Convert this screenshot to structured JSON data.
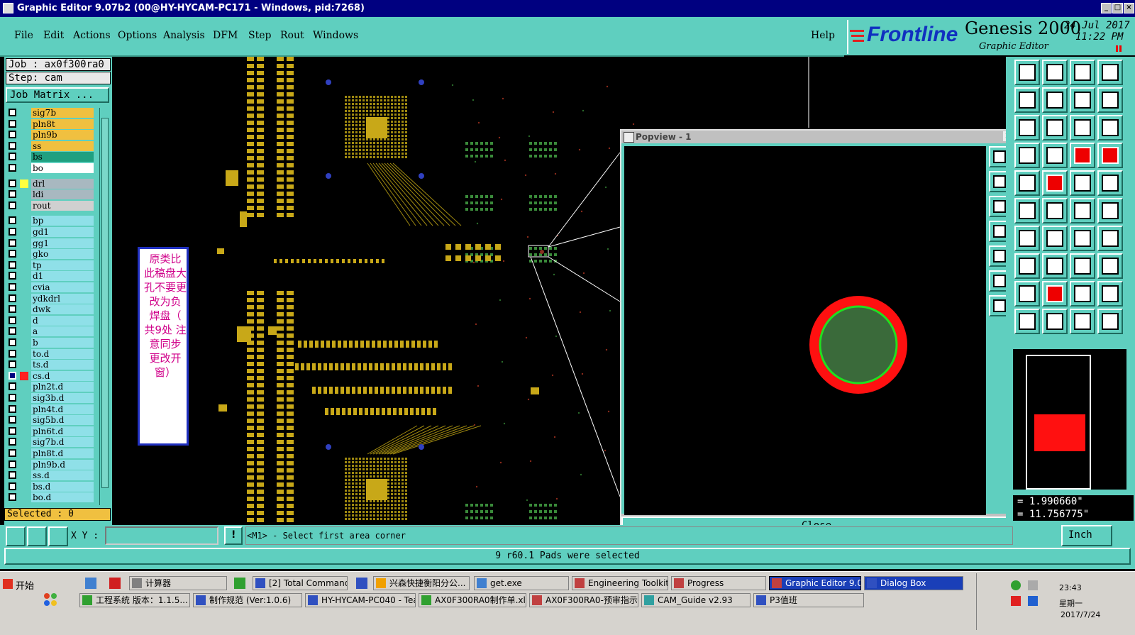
{
  "window": {
    "title": "Graphic Editor 9.07b2 (00@HY-HYCAM-PC171 - Windows, pid:7268)"
  },
  "menu": [
    "File",
    "Edit",
    "Actions",
    "Options",
    "Analysis",
    "DFM",
    "Step",
    "Rout",
    "Windows"
  ],
  "help_label": "Help",
  "brand": {
    "logo": "Frontline",
    "product": "Genesis 2000",
    "subtitle": "Graphic Editor",
    "date": "24 Jul 2017",
    "time": "11:22 PM"
  },
  "job": {
    "job_label": "Job  : ax0f300ra0",
    "step_label": "Step: cam",
    "matrix_button": "Job Matrix ..."
  },
  "layers": [
    {
      "name": "sig7b",
      "color": "#f0c040"
    },
    {
      "name": "pln8t",
      "color": "#f0c040"
    },
    {
      "name": "pln9b",
      "color": "#f0c040"
    },
    {
      "name": "ss",
      "color": "#f0c040"
    },
    {
      "name": "bs",
      "color": "#20a080"
    },
    {
      "name": "bo",
      "color": "#ffffff"
    },
    {
      "name": "drl",
      "color": "#a8b8c0",
      "swatch": "#ffff40",
      "gap": true
    },
    {
      "name": "ldi",
      "color": "#a8b8c0"
    },
    {
      "name": "rout",
      "color": "#d0d0d0"
    },
    {
      "name": "bp",
      "color": "#8fe0e8",
      "gap": true
    },
    {
      "name": "gd1",
      "color": "#8fe0e8"
    },
    {
      "name": "gg1",
      "color": "#8fe0e8"
    },
    {
      "name": "gko",
      "color": "#8fe0e8"
    },
    {
      "name": "tp",
      "color": "#8fe0e8"
    },
    {
      "name": "d1",
      "color": "#8fe0e8"
    },
    {
      "name": "cvia",
      "color": "#8fe0e8"
    },
    {
      "name": "ydkdrl",
      "color": "#8fe0e8"
    },
    {
      "name": "dwk",
      "color": "#8fe0e8"
    },
    {
      "name": "d",
      "color": "#8fe0e8"
    },
    {
      "name": "a",
      "color": "#8fe0e8"
    },
    {
      "name": "b",
      "color": "#8fe0e8"
    },
    {
      "name": "to.d",
      "color": "#8fe0e8"
    },
    {
      "name": "ts.d",
      "color": "#8fe0e8"
    },
    {
      "name": "cs.d",
      "color": "#8fe0e8",
      "swatch": "#ff2020",
      "active": true
    },
    {
      "name": "pln2t.d",
      "color": "#8fe0e8"
    },
    {
      "name": "sig3b.d",
      "color": "#8fe0e8"
    },
    {
      "name": "pln4t.d",
      "color": "#8fe0e8"
    },
    {
      "name": "sig5b.d",
      "color": "#8fe0e8"
    },
    {
      "name": "pln6t.d",
      "color": "#8fe0e8"
    },
    {
      "name": "sig7b.d",
      "color": "#8fe0e8"
    },
    {
      "name": "pln8t.d",
      "color": "#8fe0e8"
    },
    {
      "name": "pln9b.d",
      "color": "#8fe0e8"
    },
    {
      "name": "ss.d",
      "color": "#8fe0e8"
    },
    {
      "name": "bs.d",
      "color": "#8fe0e8"
    },
    {
      "name": "bo.d",
      "color": "#8fe0e8"
    }
  ],
  "selected_label": "Selected : 0",
  "annotation": {
    "lines": [
      "原",
      "比",
      "类",
      "盘",
      "此",
      "大",
      "稿",
      "孔",
      "更",
      "要",
      "不",
      "负",
      "为",
      "改",
      "盘（",
      "焊",
      "共9处",
      "注",
      "意",
      "同步",
      "更改开",
      "窗）"
    ],
    "col1": "此稿孔不改焊共9意更窗",
    "text": [
      "原类比",
      "此稿盘大",
      "孔不要更",
      "改为负",
      "焊盘（",
      "共9处  注",
      "意同步",
      "更改开",
      "窗）"
    ]
  },
  "popview": {
    "title": "Popview - 1",
    "close_label": "Close"
  },
  "coords": {
    "x": "= 1.990660\"",
    "y": "= 11.756775\"",
    "units": "Inch"
  },
  "command": {
    "xy_label": "X Y :",
    "xy_value": "",
    "prompt": "<M1> - Select first area corner"
  },
  "status": "9 r60.1 Pads were selected",
  "taskbar": {
    "start": "开始",
    "row1": [
      "计算器",
      "[2] Total Commander...",
      "兴森快捷衡阳分公...",
      "get.exe",
      "Engineering Toolkit 9...",
      "Progress",
      "Graphic Editor 9.0...",
      "Dialog Box"
    ],
    "row2": [
      "工程系统  版本：1.1.5...",
      "制作规范 (Ver:1.0.6)",
      "HY-HYCAM-PC040 - Tea...",
      "AX0F300RA0制作单.xls ...",
      "AX0F300RA0-预审指示....",
      "CAM_Guide v2.93",
      "P3值班"
    ],
    "clock_time": "23:43",
    "clock_day": "星期一",
    "clock_date": "2017/7/24"
  }
}
